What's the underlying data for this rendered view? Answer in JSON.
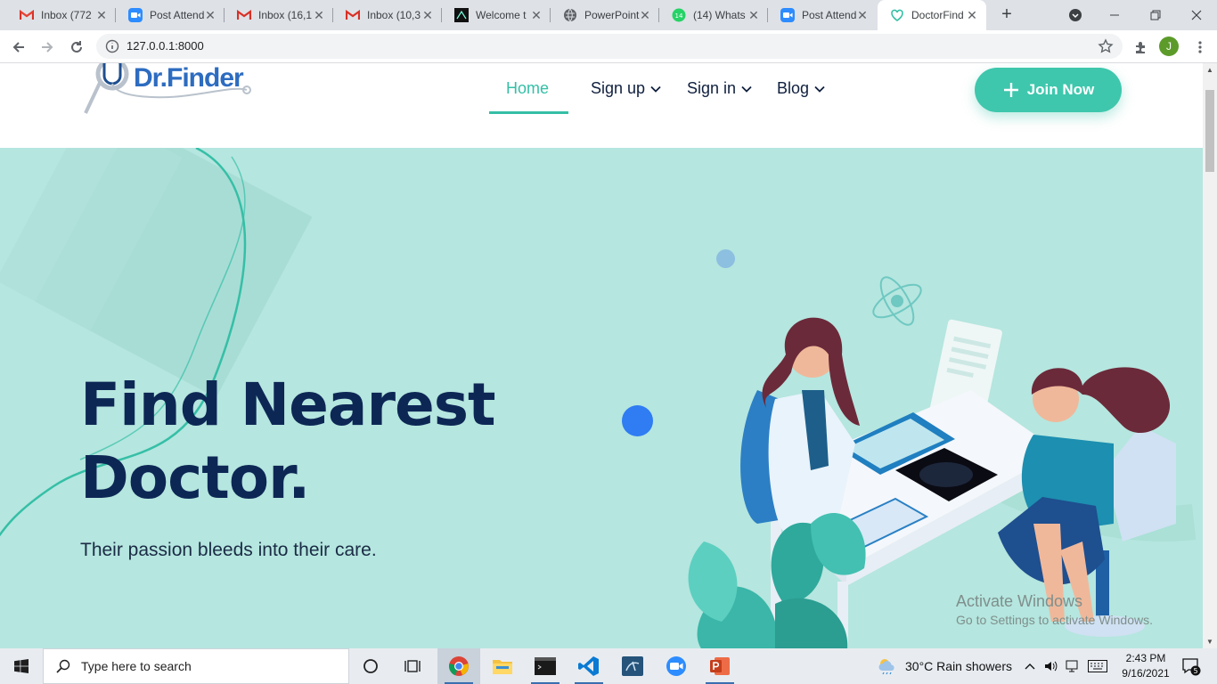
{
  "browser": {
    "tabs": [
      {
        "title": "Inbox (772",
        "icon": "gmail-icon"
      },
      {
        "title": "Post Attend",
        "icon": "zoom-icon"
      },
      {
        "title": "Inbox (16,1",
        "icon": "gmail-icon"
      },
      {
        "title": "Inbox (10,3",
        "icon": "gmail-icon"
      },
      {
        "title": "Welcome t",
        "icon": "site-icon"
      },
      {
        "title": "PowerPoint",
        "icon": "globe-icon"
      },
      {
        "title": "(14) Whats",
        "icon": "whatsapp-icon",
        "badge": "14"
      },
      {
        "title": "Post Attend",
        "icon": "zoom-icon"
      },
      {
        "title": "DoctorFind",
        "icon": "doctorfinder-icon"
      }
    ],
    "url": "127.0.0.1:8000",
    "profile_initial": "J"
  },
  "site": {
    "logo_text": "Dr.Finder",
    "nav": [
      {
        "label": "Home",
        "active": true
      },
      {
        "label": "Sign up",
        "dropdown": true
      },
      {
        "label": "Sign in",
        "dropdown": true
      },
      {
        "label": "Blog",
        "dropdown": true
      }
    ],
    "cta_label": "Join Now",
    "hero": {
      "title_line1": "Find Nearest",
      "title_line2": "Doctor.",
      "subtitle": "Their passion bleeds into their care."
    },
    "colors": {
      "accent": "#35bfa6",
      "hero_bg": "#b5e6df",
      "heading": "#0d2755"
    }
  },
  "watermark": {
    "line1": "Activate Windows",
    "line2": "Go to Settings to activate Windows."
  },
  "taskbar": {
    "search_placeholder": "Type here to search",
    "weather": "30°C  Rain showers",
    "time": "2:43 PM",
    "date": "9/16/2021",
    "notifications": "5"
  }
}
